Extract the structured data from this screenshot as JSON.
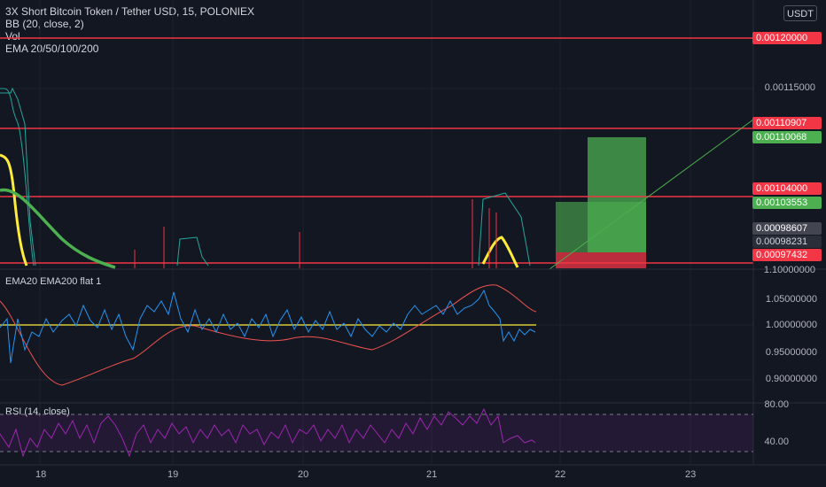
{
  "legend": {
    "symbol": "3X Short Bitcoin Token / Tether USD, 15, POLONIEX",
    "bb": "BB (20, close, 2)",
    "vol": "Vol",
    "ema": "EMA 20/50/100/200"
  },
  "currency_button": "USDT",
  "price_axis": [
    "0.00115000",
    "1.10000000"
  ],
  "price_tags": [
    {
      "label": "0.00120000",
      "bg": "#f23645",
      "fg": "#ffffff"
    },
    {
      "label": "0.00110907",
      "bg": "#f23645",
      "fg": "#ffffff"
    },
    {
      "label": "0.00110068",
      "bg": "#4caf50",
      "fg": "#ffffff"
    },
    {
      "label": "0.00104000",
      "bg": "#f23645",
      "fg": "#ffffff"
    },
    {
      "label": "0.00103553",
      "bg": "#4caf50",
      "fg": "#ffffff"
    },
    {
      "label": "0.00098607",
      "bg": "#434651",
      "fg": "#ffffff"
    },
    {
      "label": "0.00098231",
      "bg": "#2a2e39",
      "fg": "#d1d4dc"
    },
    {
      "label": "0.00097432",
      "bg": "#f23645",
      "fg": "#ffffff"
    }
  ],
  "indicator1": {
    "title": "EMA20 EMA200 flat 1",
    "axis": [
      "1.05000000",
      "1.00000000",
      "0.95000000",
      "0.90000000"
    ]
  },
  "rsi": {
    "title": "RSI (14, close)",
    "axis": [
      "80.00",
      "40.00"
    ]
  },
  "time_axis": [
    "18",
    "19",
    "20",
    "21",
    "22",
    "23"
  ],
  "colors": {
    "background": "#131722",
    "level_line": "#f23645",
    "profit_zone": "#4caf50",
    "loss_zone": "#f23645",
    "bb_line": "#26a69a",
    "ema_yellow": "#ffeb3b",
    "ema_green": "#4caf50",
    "osc_blue": "#2196f3",
    "osc_red": "#ef5350",
    "rsi_line": "#9c27b0"
  }
}
